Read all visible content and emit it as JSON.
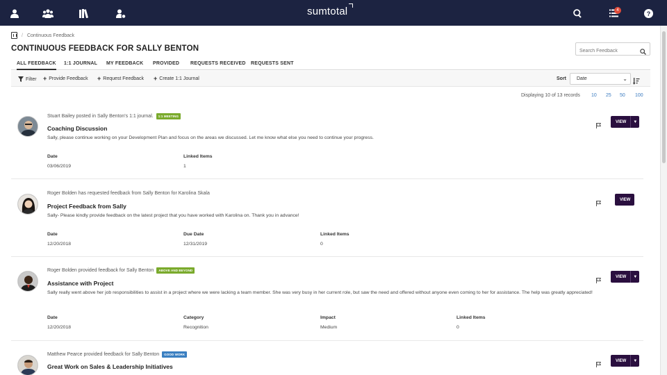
{
  "header": {
    "logo": "sumtotal",
    "icons": [
      "user-icon",
      "team-icon",
      "library-icon",
      "admin-user-icon",
      "search-icon",
      "notifications-icon",
      "help-icon"
    ],
    "notification_count": "4",
    "bg_color": "#1c2341"
  },
  "breadcrumb": {
    "current": "Continuous Feedback"
  },
  "page": {
    "title": "CONTINUOUS FEEDBACK FOR  SALLY BENTON",
    "search_placeholder": "Search Feedback"
  },
  "tabs": [
    "ALL FEEDBACK",
    "1:1 JOURNAL",
    "MY FEEDBACK",
    "PROVIDED",
    "REQUESTS RECEIVED",
    "REQUESTS SENT"
  ],
  "active_tab": "ALL FEEDBACK",
  "toolbar": {
    "filter": "Filter",
    "provide": "Provide Feedback",
    "request": "Request Feedback",
    "create_journal": "Create 1:1 Journal",
    "sort_label": "Sort",
    "sort_value": "Date"
  },
  "paging": {
    "displaying": "Displaying 10 of 13 records",
    "sizes": [
      "10",
      "25",
      "50",
      "100"
    ]
  },
  "view_label": "VIEW",
  "cards": [
    {
      "who": "Stuart Bailey posted in Sally Benton's 1:1 journal.",
      "tag": "1:1 MEETING",
      "tag_color": "#7aaa2c",
      "title": "Coaching Discussion",
      "message": "Sally, please continue working on your Development Plan and focus on the areas we discussed. Let me know what else you need to continue your progress.",
      "fields": [
        {
          "label": "Date",
          "value": "03/06/2019"
        },
        {
          "label": "Linked Items",
          "value": "1"
        }
      ]
    },
    {
      "who": "Roger Bolden has requested feedback from Sally Benton for Karolina Skala",
      "title": "Project Feedback from Sally",
      "message": "Sally- Please kindly provide feedback on the latest project that you have worked with Karolina on. Thank you in advance!",
      "fields": [
        {
          "label": "Date",
          "value": "12/20/2018"
        },
        {
          "label": "Due Date",
          "value": "12/31/2019"
        },
        {
          "label": "Linked Items",
          "value": "0"
        }
      ]
    },
    {
      "who": "Roger Bolden provided feedback for Sally Benton",
      "tag": "ABOVE AND BEYOND",
      "tag_color": "#7aaa2c",
      "title": "Assistance with Project",
      "message": "Sally really went above her job responsibilities to assist in a project where we were lacking a team member. She was very busy in her current role, but saw the need and offered without anyone even coming to her for assistance. The help was greatly appreciated!",
      "fields": [
        {
          "label": "Date",
          "value": "12/20/2018"
        },
        {
          "label": "Category",
          "value": "Recognition"
        },
        {
          "label": "Impact",
          "value": "Medium"
        },
        {
          "label": "Linked Items",
          "value": "0"
        }
      ]
    },
    {
      "who": "Matthew Pearce provided feedback for Sally Benton",
      "tag": "GOOD WORK",
      "tag_color": "#3a7fc1",
      "title": "Great Work on Sales & Leadership Initiatives"
    }
  ]
}
